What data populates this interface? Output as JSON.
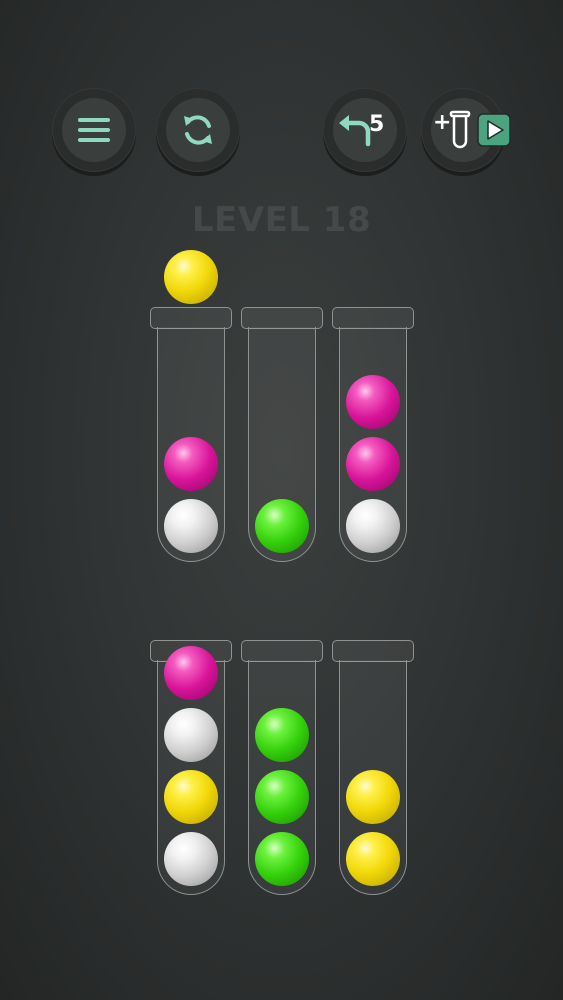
{
  "hud": {
    "level_label": "LEVEL 18",
    "undo_count": "5",
    "add_tube_prefix": "+"
  },
  "colors": {
    "yellow": "#f2d90a",
    "pink": "#d9149a",
    "white": "#cfcfcf",
    "green": "#35d10c",
    "button_bg": "#3a3f3e",
    "icon": "#8fd9c0",
    "ad_badge": "#4ca37f"
  },
  "icons": [
    "menu-icon",
    "restart-icon",
    "undo-icon",
    "add-tube-icon",
    "video-ad-icon"
  ],
  "lifted_ball": "yellow",
  "tubes": [
    {
      "id": "tube-1",
      "balls_bottom_to_top": [
        "white",
        "pink"
      ]
    },
    {
      "id": "tube-2",
      "balls_bottom_to_top": [
        "green"
      ]
    },
    {
      "id": "tube-3",
      "balls_bottom_to_top": [
        "white",
        "pink",
        "pink"
      ]
    },
    {
      "id": "tube-4",
      "balls_bottom_to_top": [
        "white",
        "yellow",
        "white",
        "pink"
      ]
    },
    {
      "id": "tube-5",
      "balls_bottom_to_top": [
        "green",
        "green",
        "green"
      ]
    },
    {
      "id": "tube-6",
      "balls_bottom_to_top": [
        "yellow",
        "yellow"
      ]
    }
  ]
}
